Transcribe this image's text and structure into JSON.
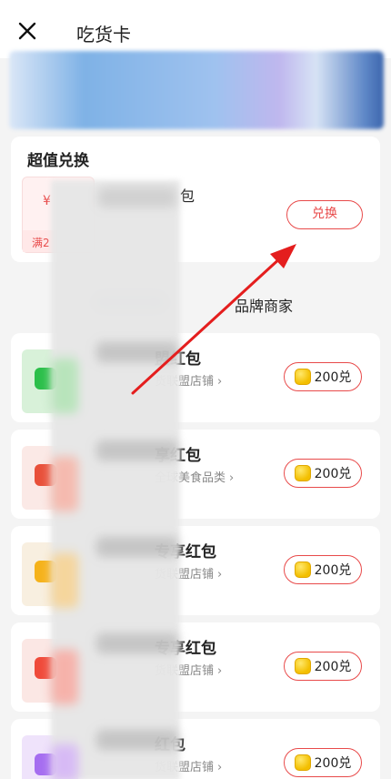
{
  "header": {
    "title": "吃货卡",
    "close_icon": "close-icon"
  },
  "exchange_section": {
    "title": "超值兑换",
    "coupon": {
      "symbol": "¥",
      "condition": "满2"
    },
    "item_name": "包",
    "button_label": "兑换"
  },
  "tabs": {
    "brand_label": "品牌商家"
  },
  "brand_list": [
    {
      "name": "盟红包",
      "sub": "货联盟店铺",
      "price": "200兑",
      "icon_bg": "#d8f1d9",
      "icon_color": "#2bbf4a",
      "icon": "basket-icon"
    },
    {
      "name": "享红包",
      "sub": "全球美食品类",
      "price": "200兑",
      "icon_bg": "#fbe9e6",
      "icon_color": "#e8503a",
      "icon": "bowl-icon"
    },
    {
      "name": "专享红包",
      "sub": "货联盟店铺",
      "price": "200兑",
      "icon_bg": "#f8efe0",
      "icon_color": "#f5b21a",
      "icon": "cup-icon"
    },
    {
      "name": "专享红包",
      "sub": "货联盟店铺",
      "price": "200兑",
      "icon_bg": "#fbe7e4",
      "icon_color": "#ef4a3a",
      "icon": "food-icon"
    },
    {
      "name": "红包",
      "sub": "货联盟店铺",
      "price": "200兑",
      "icon_bg": "#efe3fb",
      "icon_color": "#a56df0",
      "icon": "gift-icon"
    }
  ],
  "accent_color": "#e84a4a"
}
